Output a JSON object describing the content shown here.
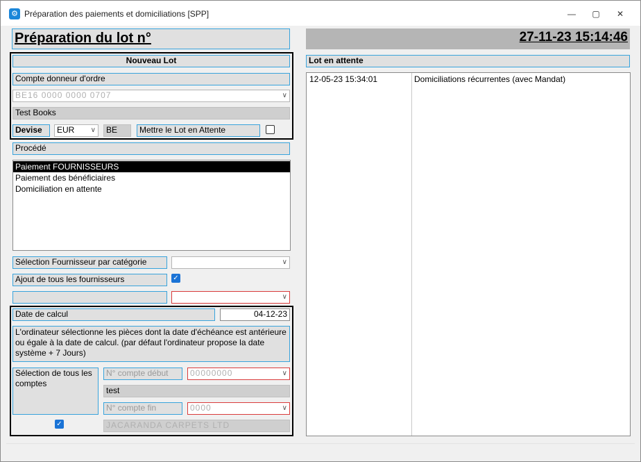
{
  "window": {
    "title": "Préparation des paiements et domiciliations [SPP]",
    "minimize": "—",
    "maximize": "▢",
    "close": "✕"
  },
  "header": {
    "title": "Préparation du lot n°",
    "timestamp": "27-11-23 15:14:46"
  },
  "new_lot": {
    "heading": "Nouveau Lot",
    "account_label": "Compte donneur d'ordre",
    "account_value": "BE16 0000 0000 0707",
    "account_name": "Test Books",
    "currency_label": "Devise",
    "currency_value": "EUR",
    "country_code": "BE",
    "pending_label": "Mettre le Lot en Attente",
    "pending_checked": false
  },
  "process": {
    "label": "Procédé",
    "items": [
      "Paiement FOURNISSEURS",
      "Paiement des bénéficiaires",
      "Domiciliation en attente"
    ],
    "selected_index": 0
  },
  "suppliers": {
    "category_label": "Sélection Fournisseur par catégorie",
    "category_value": "",
    "add_all_label": "Ajout de tous les fournisseurs",
    "add_all_checked": true
  },
  "calc": {
    "date_label": "Date de calcul",
    "date_value": "04-12-23",
    "info": "L'ordinateur sélectionne les pièces dont la date d'échéance est antérieure ou égale à la date de calcul. (par défaut l'ordinateur propose la date système + 7 Jours)",
    "all_accounts_label": "Sélection de tous les comptes",
    "all_accounts_checked": true,
    "start_label": "N° compte début",
    "start_value": "00000000",
    "start_name": "test",
    "end_label": "N° compte fin",
    "end_value": "0000",
    "end_name": "JACARANDA CARPETS LTD"
  },
  "pending": {
    "label": "Lot en attente",
    "rows": [
      {
        "date": "12-05-23 15:34:01",
        "description": "Domiciliations récurrentes (avec Mandat)"
      }
    ]
  }
}
